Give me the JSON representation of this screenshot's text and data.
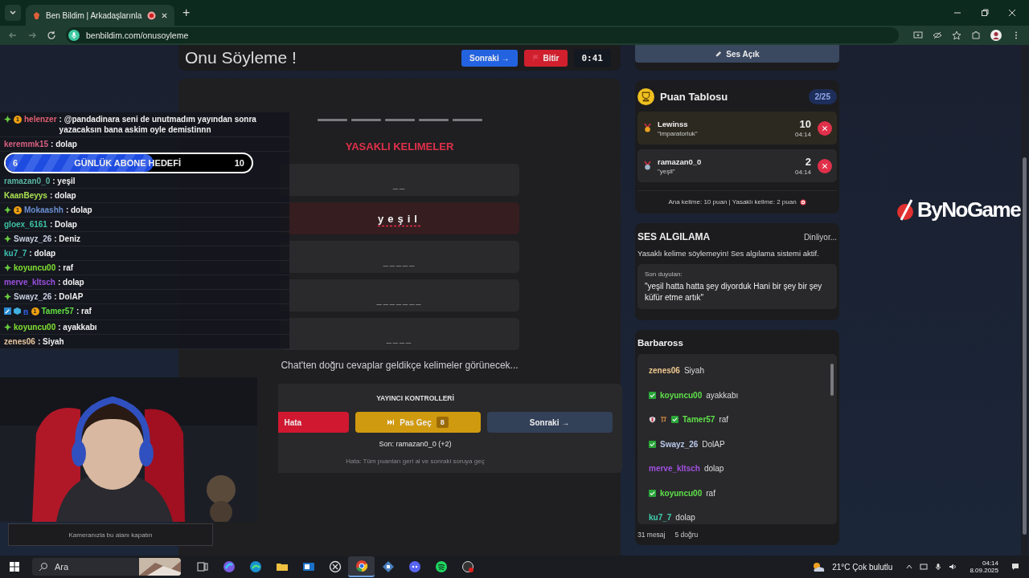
{
  "browser": {
    "tab": {
      "title": "Ben Bildim | Arkadaşlarınla",
      "recording": true
    },
    "new_tab": "+",
    "address": "benbildim.com/onusoyleme"
  },
  "header": {
    "title": "Onu Söyleme !",
    "next_button": "Sonraki →",
    "finish_button": "Bitir",
    "timer": "0:41"
  },
  "sound_button": "Ses Açık",
  "game": {
    "word_slots": [
      {
        "revealed": false
      },
      {
        "revealed": false
      },
      {
        "revealed": false
      },
      {
        "revealed": false
      },
      {
        "revealed": false
      }
    ],
    "forbidden_title": "YASAKLI KELIMELER",
    "forbidden_words": [
      {
        "text": "__",
        "revealed": false
      },
      {
        "text": "yeşil",
        "revealed": true
      },
      {
        "text": "_____",
        "revealed": false
      },
      {
        "text": "_______",
        "revealed": false
      },
      {
        "text": "____",
        "revealed": false
      }
    ],
    "hint": "Chat'ten doğru cevaplar geldikçe kelimeler görünecek..."
  },
  "controls": {
    "title": "YAYINCI KONTROLLERİ",
    "buttons": [
      {
        "kind": "error",
        "label": "Hata"
      },
      {
        "kind": "skip",
        "label": "Pas Geç",
        "count": "8"
      },
      {
        "kind": "next",
        "label": "Sonraki →"
      }
    ],
    "last": "Son: ramazan0_0 (+2)",
    "note": "Hata: Tüm puanları geri al ve sonraki soruya geç"
  },
  "scoreboard": {
    "title": "Puan Tablosu",
    "round": "2/25",
    "rows": [
      {
        "kind": "gold",
        "name": "Lewinss",
        "word": "\"imparatorluk\"",
        "points": "10",
        "time": "04:14"
      },
      {
        "kind": "silver",
        "name": "ramazan0_0",
        "word": "\"yeşil\"",
        "points": "2",
        "time": "04:14"
      }
    ],
    "rules": "Ana kelime: 10 puan | Yasaklı kelime: 2 puan"
  },
  "voice": {
    "title": "SES ALGILAMA",
    "status": "Dinliyor...",
    "description": "Yasaklı kelime söylemeyin! Ses algılama sistemi aktif.",
    "heard_label": "Son duyulan:",
    "heard_text": "\"yeşil hatta hatta şey diyorduk Hani bir şey bir şey küfür etme artık\""
  },
  "chat_panel": {
    "title": "Barbaross",
    "messages": [
      {
        "name": "zenes06",
        "color": "#f0c890",
        "text": "Siyah"
      },
      {
        "name": "koyuncu00",
        "color": "#5ee04a",
        "text": "ayakkabı",
        "badges": [
          {
            "kind": "check"
          }
        ]
      },
      {
        "name": "Tamer57",
        "color": "#5ee04a",
        "text": "raf",
        "badges": [
          {
            "kind": "shield"
          },
          {
            "kind": "tool"
          },
          {
            "kind": "check"
          }
        ]
      },
      {
        "name": "Swayz_26",
        "color": "#b8c8e8",
        "text": "DolAP",
        "badges": [
          {
            "kind": "check"
          }
        ]
      },
      {
        "name": "merve_kltsch",
        "color": "#a050e0",
        "text": "dolap"
      },
      {
        "name": "koyuncu00",
        "color": "#5ee04a",
        "text": "raf",
        "badges": [
          {
            "kind": "check"
          }
        ]
      },
      {
        "name": "ku7_7",
        "color": "#40d0b0",
        "text": "dolap"
      }
    ],
    "count": "31 mesaj",
    "correct": "5 doğru"
  },
  "stream_overlay": {
    "chat": [
      {
        "name": "helenzer",
        "color": "#e06070",
        "text": ": @pandadinara seni de unutmadım yayından sonra yazacaksın bana askim oyle demistinnn",
        "badges": [
          {
            "kind": "sub"
          },
          {
            "kind": "coin",
            "text": "1"
          }
        ]
      },
      {
        "name": "keremmk15",
        "color": "#d8607e",
        "text": ": dolap"
      },
      {
        "name": "ramazan0_0",
        "color": "#5ab4a0",
        "text": ": yeşil"
      },
      {
        "name": "KaanBeyys",
        "color": "#a8e050",
        "text": ": dolap"
      },
      {
        "name": "Mokaashh",
        "color": "#6a8fd0",
        "text": ": dolap",
        "badges": [
          {
            "kind": "sub"
          },
          {
            "kind": "coin",
            "text": "1"
          }
        ]
      },
      {
        "name": "gloex_6161",
        "color": "#3cc0a0",
        "text": ": Dolap"
      },
      {
        "name": "Swayz_26",
        "color": "#c8d0e0",
        "text": ": Deniz",
        "badges": [
          {
            "kind": "sub"
          }
        ]
      },
      {
        "name": "ku7_7",
        "color": "#3cc0b0",
        "text": ": dolap"
      },
      {
        "name": "koyuncu00",
        "color": "#80e030",
        "text": ": raf",
        "badges": [
          {
            "kind": "sub"
          }
        ]
      },
      {
        "name": "merve_kltsch",
        "color": "#9a50e0",
        "text": ": dolap"
      },
      {
        "name": "Swayz_26",
        "color": "#c8d0e0",
        "text": ": DolAP",
        "badges": [
          {
            "kind": "sub"
          }
        ]
      },
      {
        "name": "Tamer57",
        "color": "#60e040",
        "text": ": raf",
        "badges": [
          {
            "kind": "tool"
          },
          {
            "kind": "cube"
          },
          {
            "kind": "letter",
            "text": "B"
          },
          {
            "kind": "coin",
            "text": "1"
          }
        ]
      },
      {
        "name": "koyuncu00",
        "color": "#80e030",
        "text": ": ayakkabı",
        "badges": [
          {
            "kind": "sub"
          }
        ]
      },
      {
        "name": "zenes06",
        "color": "#e8c8a0",
        "text": ": Siyah"
      }
    ],
    "goal": {
      "start": "6",
      "title": "GÜNLÜK ABONE HEDEFİ",
      "end": "10",
      "level": 0.6
    },
    "camera_notice": "Kameranızla bu alanı kapatın",
    "logo": "ByNoGame"
  },
  "taskbar": {
    "search": "Ara",
    "apps": [
      {
        "kind": "taskview",
        "selected": false
      },
      {
        "kind": "swirl",
        "selected": false
      },
      {
        "kind": "globe",
        "selected": false
      },
      {
        "kind": "folder",
        "selected": false
      },
      {
        "kind": "mail",
        "selected": false
      },
      {
        "kind": "xcircle",
        "selected": false
      },
      {
        "kind": "chrome",
        "selected": true
      },
      {
        "kind": "diamond",
        "selected": false
      },
      {
        "kind": "chat",
        "selected": false
      },
      {
        "kind": "music",
        "selected": false
      },
      {
        "kind": "record",
        "selected": false
      }
    ],
    "weather": "21°C Çok bulutlu",
    "time": "04:14",
    "date": "8.09.2025"
  }
}
